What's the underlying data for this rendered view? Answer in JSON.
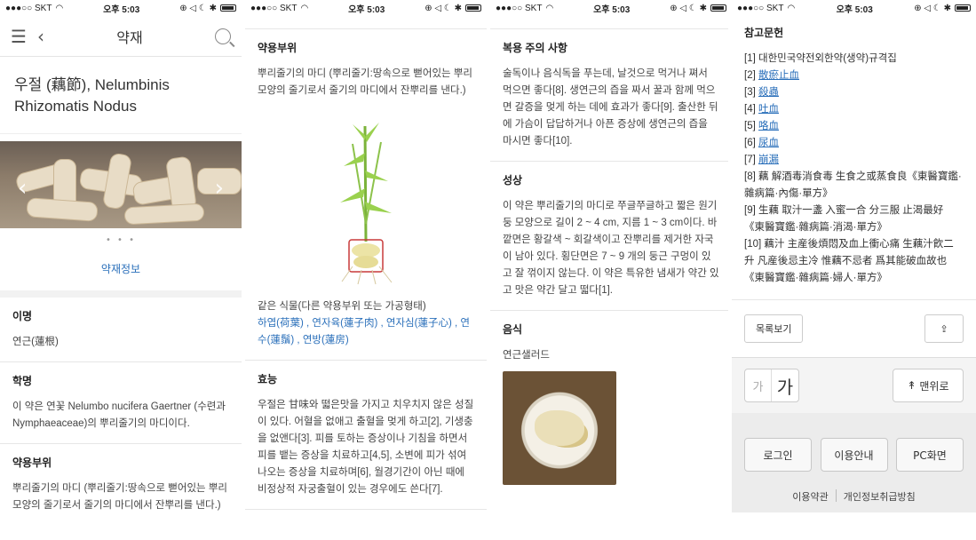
{
  "status": {
    "carrier": "●●●○○ SKT",
    "time": "오후 5:03",
    "icons": "⊕ ◁ ☾ ✱"
  },
  "nav": {
    "title": "약재"
  },
  "herb": {
    "title": "우절 (藕節), Nelumbinis Rhizomatis Nodus"
  },
  "carousel": {
    "dots": "• • •",
    "info_link": "약재정보"
  },
  "sections": {
    "alias_h": "이명",
    "alias_b": "연근(蓮根)",
    "sci_h": "학명",
    "sci_b": "이 약은 연꽃 Nelumbo nucifera Gaertner (수련과 Nymphaeaceae)의 뿌리줄기의 마디이다.",
    "part_h": "약용부위",
    "part_b": "뿌리줄기의 마디 (뿌리줄기:땅속으로 뻗어있는 뿌리모양의 줄기로서 줄기의 마디에서 잔뿌리를 낸다.)",
    "same_plant": "같은 식물(다른 약용부위 또는 가공형태)",
    "same_links": "하엽(荷葉) , 연자육(蓮子肉) , 연자심(蓮子心) , 연수(蓮鬚) , 연방(蓮房)",
    "effect_h": "효능",
    "effect_b": "우절은 甘味와 떫은맛을 가지고 치우치지 않은 성질이 있다. 어혈을 없애고 출혈을 멎게 하고[2], 기생충을 없앤다[3]. 피를 토하는 증상이나 기침을 하면서 피를 뱉는 증상을 치료하고[4,5], 소변에 피가 섞여나오는 증상을 치료하며[6], 월경기간이 아닌 때에 비정상적 자궁출혈이 있는 경우에도 쓴다[7].",
    "caution_h": "복용 주의 사항",
    "caution_b": "술독이나 음식독을 푸는데, 날것으로 먹거나 쪄서 먹으면 좋다[8]. 생연근의 즙을 짜서 꿀과 함께 먹으면 갈증을 멎게 하는 데에 효과가 좋다[9]. 출산한 뒤에 가슴이 답답하거나 아픈 증상에 생연근의 즙을 마시면 좋다[10].",
    "shape_h": "성상",
    "shape_b": "이 약은 뿌리줄기의 마디로 쭈글쭈글하고 짧은 원기둥 모양으로 길이 2 ~ 4 cm, 지름 1 ~ 3 cm이다. 바깥면은 황갈색 ~ 회갈색이고 잔뿌리를 제거한 자국이 남아 있다. 횡단면은 7 ~ 9 개의 둥근 구멍이 있고 잘 꺾이지 않는다. 이 약은 특유한 냄새가 약간 있고 맛은 약간 달고 떫다[1].",
    "food_h": "음식",
    "food_b": "연근샐러드"
  },
  "references": {
    "title": "참고문헌",
    "items": [
      {
        "n": "[1]",
        "text": "대한민국약전외한약(생약)규격집",
        "link": false
      },
      {
        "n": "[2]",
        "text": "散瘀止血",
        "link": true
      },
      {
        "n": "[3]",
        "text": "殺蟲",
        "link": true
      },
      {
        "n": "[4]",
        "text": "吐血",
        "link": true
      },
      {
        "n": "[5]",
        "text": "咯血",
        "link": true
      },
      {
        "n": "[6]",
        "text": "尿血",
        "link": true
      },
      {
        "n": "[7]",
        "text": "崩漏",
        "link": true
      },
      {
        "n": "[8]",
        "text": "藕 解酒毒消食毒 生食之或蒸食良《東醫寶鑑·雜病篇·內傷·單方》",
        "link": false
      },
      {
        "n": "[9]",
        "text": "生藕 取汁一盞 入蜜一合 分三服 止渴最好《東醫寶鑑·雜病篇·消渴·單方》",
        "link": false
      },
      {
        "n": "[10]",
        "text": "藕汁 主産後煩悶及血上衝心痛 生藕汁飮二升 凡産後忌主冷 惟藕不忌者 爲其能破血故也《東醫寶鑑·雜病篇·婦人·單方》",
        "link": false
      }
    ]
  },
  "actions": {
    "list": "목록보기",
    "font_small": "가",
    "font_big": "가",
    "top": "맨위로",
    "login": "로그인",
    "guide": "이용안내",
    "pc": "PC화면",
    "terms": "이용약관",
    "privacy": "개인정보취급방침"
  }
}
